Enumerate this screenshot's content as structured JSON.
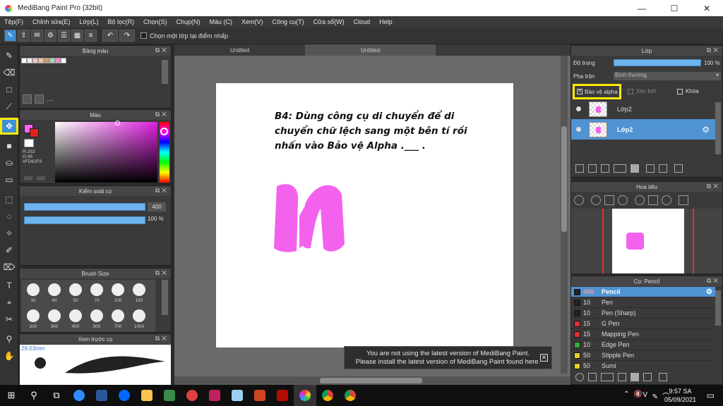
{
  "window": {
    "title": "MediBang Paint Pro (32bit)",
    "controls": [
      "—",
      "☐",
      "✕"
    ]
  },
  "menu": [
    "Tệp(F)",
    "Chỉnh sửa(E)",
    "Lớp(L)",
    "Bộ lọc(R)",
    "Chọn(S)",
    "Chụp(N)",
    "Màu (C)",
    "Xem(V)",
    "Công cụ(T)",
    "Cửa sổ(W)",
    "Cloud",
    "Help"
  ],
  "toolbar": {
    "checkbox_label": "Chọn một lớp tại điểm nhấp"
  },
  "panels": {
    "color_bar": "Bảng màu",
    "color_bar_ellipsis": "....",
    "color": "Màu",
    "color_values": {
      "r": "R:253",
      "g": "G:98",
      "hex": "#FD62F9"
    },
    "brush_control": "Kiểm soát cọ",
    "brush_size_value": "400",
    "brush_opacity_value": "100 %",
    "brush_size": "Brush Size",
    "brush_sizes": [
      "30",
      "40",
      "50",
      "70",
      "100",
      "150",
      "200",
      "300",
      "400",
      "500",
      "700",
      "1000"
    ],
    "preview": "Xem trước cọ",
    "preview_size": "29.03mm"
  },
  "canvas": {
    "tabs": [
      "Untitled",
      "Untitled"
    ],
    "note": "B4: Dùng công cụ di chuyển để di chuyển chữ lệch sang một bên tí rồi nhấn vào Bảo vệ Alpha .___ .",
    "stroke_color": "#F362ED"
  },
  "toast": {
    "line1": "You are not using the latest version of MediBang Paint.",
    "line2": "Please install the latest version of MediBang Paint found here."
  },
  "layer_panel": {
    "title": "Lớp",
    "opacity_label": "Độ trong",
    "opacity_value": "100 %",
    "blend_label": "Pha trộn",
    "blend_value": "Bình thường",
    "alpha_protect": "Bảo vệ alpha",
    "clipping": "Xén bớt",
    "lock": "Khóa",
    "layers": [
      "Lớp2",
      "Lớp2"
    ]
  },
  "navigator": {
    "title": "Hoa tiêu"
  },
  "brush_panel": {
    "title": "Cọ: Pencil",
    "brushes": [
      {
        "size": "400",
        "name": "Pencil",
        "color": "#222222",
        "selected": true
      },
      {
        "size": "10",
        "name": "Pen",
        "color": "#222222"
      },
      {
        "size": "10",
        "name": "Pen (Sharp)",
        "color": "#222222"
      },
      {
        "size": "15",
        "name": "G Pen",
        "color": "#e03030"
      },
      {
        "size": "15",
        "name": "Mapping Pen",
        "color": "#e03030"
      },
      {
        "size": "10",
        "name": "Edge Pen",
        "color": "#30b030"
      },
      {
        "size": "50",
        "name": "Stipple Pen",
        "color": "#e8d020"
      },
      {
        "size": "50",
        "name": "Sumi",
        "color": "#e8d020"
      }
    ]
  },
  "taskbar": {
    "time": "9:57 SA",
    "date": "05/09/2021",
    "lang": "V"
  }
}
